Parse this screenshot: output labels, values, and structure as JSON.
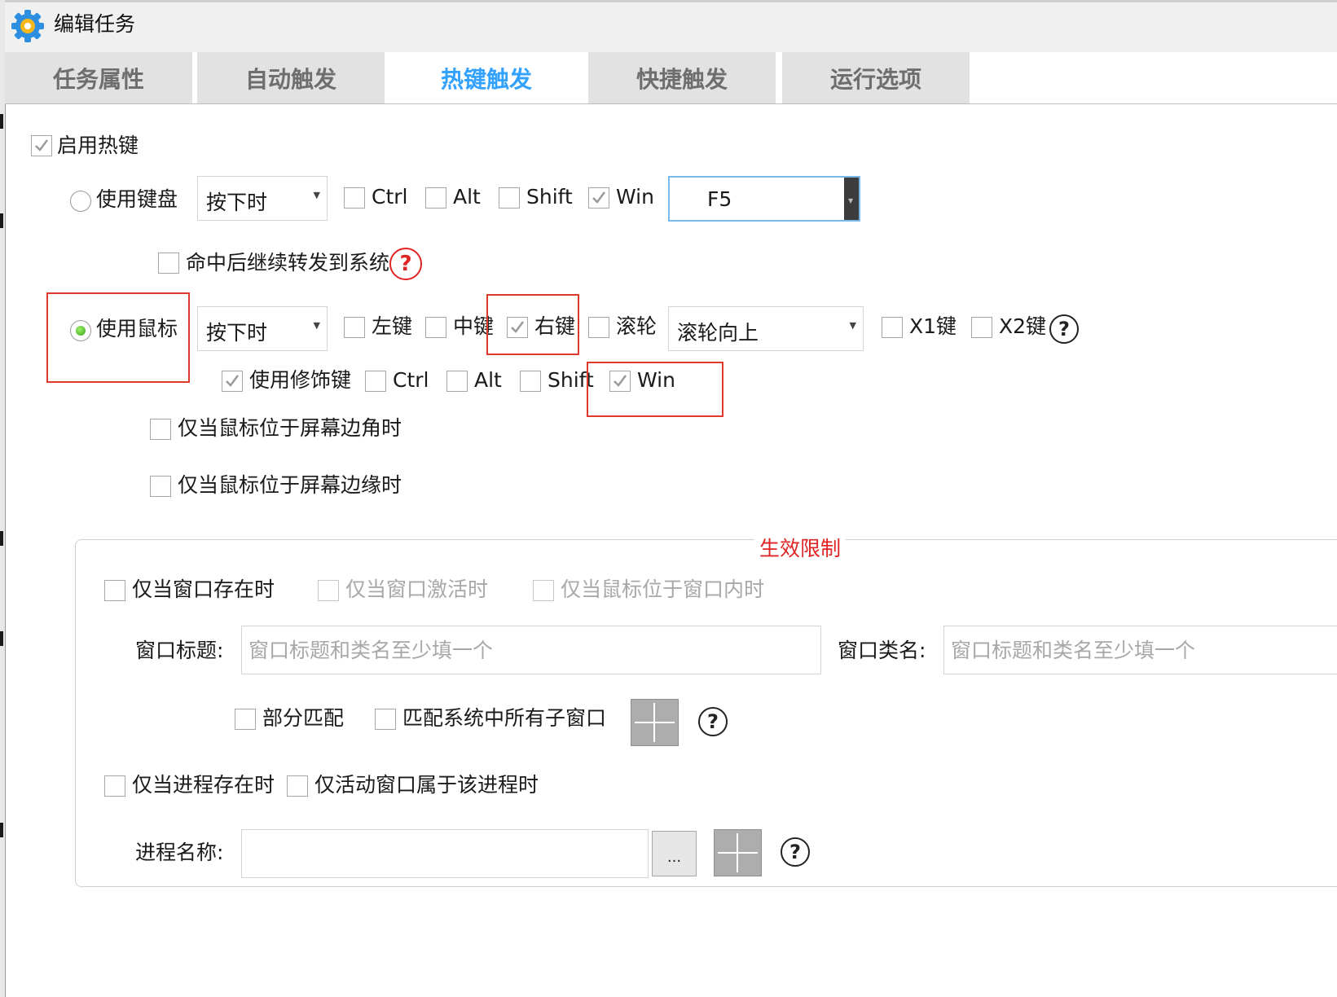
{
  "window": {
    "title": "编辑任务"
  },
  "tabs": [
    {
      "label": "任务属性"
    },
    {
      "label": "自动触发"
    },
    {
      "label": "热键触发",
      "active": true
    },
    {
      "label": "快捷触发"
    },
    {
      "label": "运行选项"
    }
  ],
  "hotkey": {
    "enable_label": "启用热键",
    "enable_checked": true,
    "keyboard": {
      "radio_label": "使用键盘",
      "selected": false,
      "trigger_value": "按下时",
      "mods": [
        {
          "label": "Ctrl",
          "checked": false
        },
        {
          "label": "Alt",
          "checked": false
        },
        {
          "label": "Shift",
          "checked": false
        },
        {
          "label": "Win",
          "checked": true
        }
      ],
      "key_value": "F5",
      "forward_label": "命中后继续转发到系统",
      "forward_checked": false,
      "help": "?"
    },
    "mouse": {
      "radio_label": "使用鼠标",
      "selected": true,
      "trigger_value": "按下时",
      "buttons": [
        {
          "label": "左键",
          "checked": false
        },
        {
          "label": "中键",
          "checked": false
        },
        {
          "label": "右键",
          "checked": true
        },
        {
          "label": "滚轮",
          "checked": false
        }
      ],
      "wheel_value": "滚轮向上",
      "extra": [
        {
          "label": "X1键",
          "checked": false
        },
        {
          "label": "X2键",
          "checked": false
        }
      ],
      "help": "?",
      "use_mods_label": "使用修饰键",
      "use_mods_checked": true,
      "mods": [
        {
          "label": "Ctrl",
          "checked": false
        },
        {
          "label": "Alt",
          "checked": false
        },
        {
          "label": "Shift",
          "checked": false
        },
        {
          "label": "Win",
          "checked": true
        }
      ],
      "corner_label": "仅当鼠标位于屏幕边角时",
      "corner_checked": false,
      "edge_label": "仅当鼠标位于屏幕边缘时",
      "edge_checked": false
    }
  },
  "limits": {
    "title": "生效限制",
    "window_exists_label": "仅当窗口存在时",
    "window_active_label": "仅当窗口激活时",
    "mouse_in_window_label": "仅当鼠标位于窗口内时",
    "window_title_label": "窗口标题:",
    "window_title_placeholder": "窗口标题和类名至少填一个",
    "window_class_label": "窗口类名:",
    "window_class_placeholder": "窗口标题和类名至少填一个",
    "partial_match_label": "部分匹配",
    "match_children_label": "匹配系统中所有子窗口",
    "help": "?",
    "process_exists_label": "仅当进程存在时",
    "active_window_process_label": "仅活动窗口属于该进程时",
    "process_name_label": "进程名称:",
    "process_name_value": "",
    "browse_label": "..."
  },
  "colors": {
    "tab_active_text": "#33a2ff",
    "highlight_box": "#e0392b",
    "group_title": "#e02424",
    "radio_selected": "#3aa31a"
  },
  "icons": {
    "app": "gear-icon",
    "help": "question-circle-icon",
    "finder": "crosshair-icon",
    "check": "check-icon"
  }
}
